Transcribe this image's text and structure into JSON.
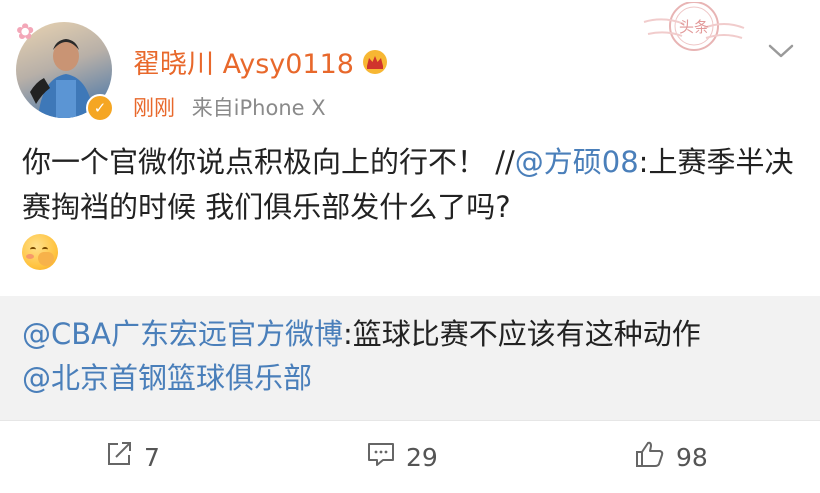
{
  "post": {
    "username": "翟晓川 Aysy0118",
    "time": "刚刚",
    "source": "来自iPhone X",
    "stamp_text": "头条",
    "content": {
      "text_before": "你一个官微你说点积极向上的行不！ //",
      "mention": "@方硕08",
      "text_after": ":上赛季半决赛掏裆的时候 我们俱乐部发什么了吗?"
    }
  },
  "repost": {
    "mention1": "@CBA广东宏远官方微博",
    "text": ":篮球比赛不应该有这种动作",
    "mention2": "@北京首钢篮球俱乐部"
  },
  "toolbar": {
    "repost_count": "7",
    "comment_count": "29",
    "like_count": "98"
  },
  "colors": {
    "username": "#e8682b",
    "mention": "#4a7fba",
    "repost_bg": "#f2f2f2"
  },
  "icons": [
    "avatar",
    "verified-badge-icon",
    "crown-icon",
    "stamp-icon",
    "chevron-down-icon",
    "smiley-emoji-icon",
    "repost-icon",
    "comment-icon",
    "like-icon"
  ]
}
